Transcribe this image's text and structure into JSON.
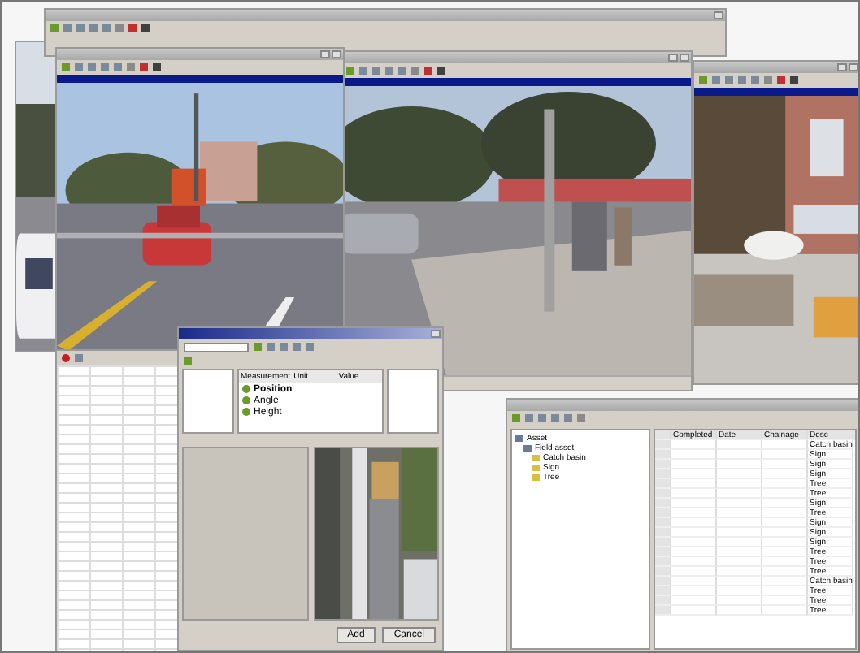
{
  "asset_dialog": {
    "columns": [
      "Measurement",
      "Unit",
      "Value"
    ],
    "measurements": [
      "Position",
      "Angle",
      "Height"
    ],
    "buttons": [
      "Add",
      "Cancel"
    ]
  },
  "asset_window": {
    "tree": [
      {
        "label": "Asset",
        "children": [
          {
            "label": "Field asset",
            "children": [
              {
                "label": "Catch basin"
              },
              {
                "label": "Sign"
              },
              {
                "label": "Tree"
              }
            ]
          }
        ]
      }
    ],
    "table": {
      "columns": [
        "Completed",
        "Date",
        "Chainage",
        "Desc"
      ],
      "rows": [
        "Catch basin",
        "Sign",
        "Sign",
        "Sign",
        "Tree",
        "Tree",
        "Sign",
        "Tree",
        "Sign",
        "Sign",
        "Sign",
        "Tree",
        "Tree",
        "Tree",
        "Catch basin",
        "Tree",
        "Tree",
        "Tree"
      ]
    }
  }
}
